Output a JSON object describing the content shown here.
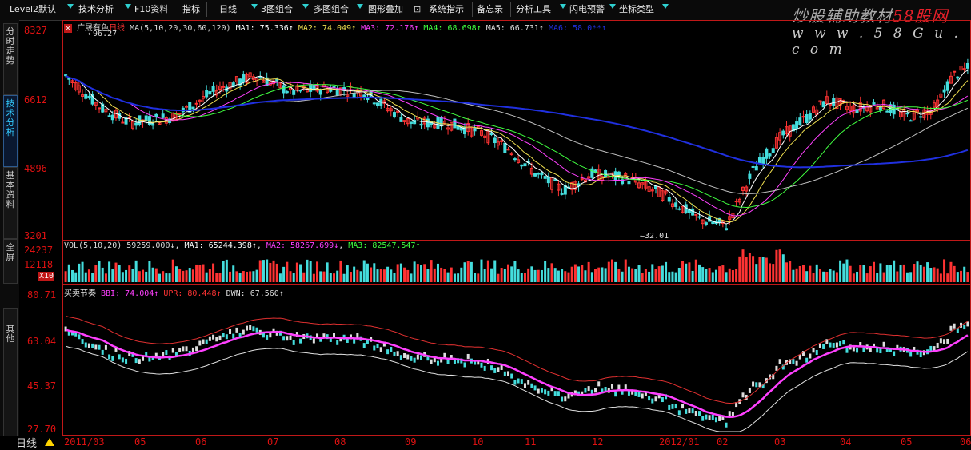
{
  "toolbar": {
    "items": [
      {
        "label": "Level2默认"
      },
      {
        "label": "技术分析"
      },
      {
        "label": "F10资料"
      },
      {
        "label": "指标"
      },
      {
        "label": "日线"
      },
      {
        "label": "3图组合"
      },
      {
        "label": "多图组合"
      },
      {
        "label": "图形叠加"
      },
      {
        "label": "系统指示"
      },
      {
        "label": "备忘录"
      },
      {
        "label": "分析工具"
      },
      {
        "label": "闪电预警"
      },
      {
        "label": "坐标类型"
      }
    ]
  },
  "watermark": {
    "line1_a": "炒股辅助教材",
    "line1_b": "58股网",
    "line2": "w w w . 5 8 G u . c o m"
  },
  "sidebar": {
    "tabs": [
      "分时走势",
      "技术分析",
      "基本资料",
      "全屏",
      "其他"
    ]
  },
  "main_panel": {
    "stock_name": "广晟有色",
    "period": "日线",
    "ma_params": "MA(5,10,20,30,60,120)",
    "ma1": "MA1: 75.336↑",
    "ma2": "MA2: 74.049↑",
    "ma3": "MA3: 72.176↑",
    "ma4": "MA4: 68.698↑",
    "ma5": "MA5: 66.731↑",
    "ma6": "MA6: 58.0**↑",
    "y_labels": [
      "8327",
      "6612",
      "4896",
      "3201"
    ],
    "high_mark": "96.27",
    "low_mark": "32.01"
  },
  "vol_panel": {
    "title": "VOL(5,10,20)",
    "vol": "59259.000↓",
    "ma1": "MA1: 65244.398↑",
    "ma2": "MA2: 58267.699↓",
    "ma3": "MA3: 82547.547↑",
    "y_labels": [
      "24237",
      "12118",
      "X10"
    ]
  },
  "ind_panel": {
    "title": "买卖节奏",
    "bbi": "BBI: 74.004↑",
    "upr": "UPR: 80.448↑",
    "dwn": "DWN: 67.560↑",
    "y_labels": [
      "80.71",
      "63.04",
      "45.37",
      "27.70"
    ]
  },
  "x_axis": {
    "ticks": [
      "2011/03",
      "05",
      "06",
      "07",
      "08",
      "09",
      "10",
      "11",
      "12",
      "2012/01",
      "02",
      "03",
      "04",
      "05",
      "06"
    ],
    "period_label": "日线"
  },
  "colors": {
    "bg": "#000000",
    "grid": "#c01818",
    "up": "#ff3333",
    "down": "#44dddd",
    "ma1": "#ffffff",
    "ma2": "#f0e050",
    "ma3": "#ff40ff",
    "ma4": "#40ff40",
    "ma5": "#c0c0c0",
    "ma6": "#2030e0"
  }
}
